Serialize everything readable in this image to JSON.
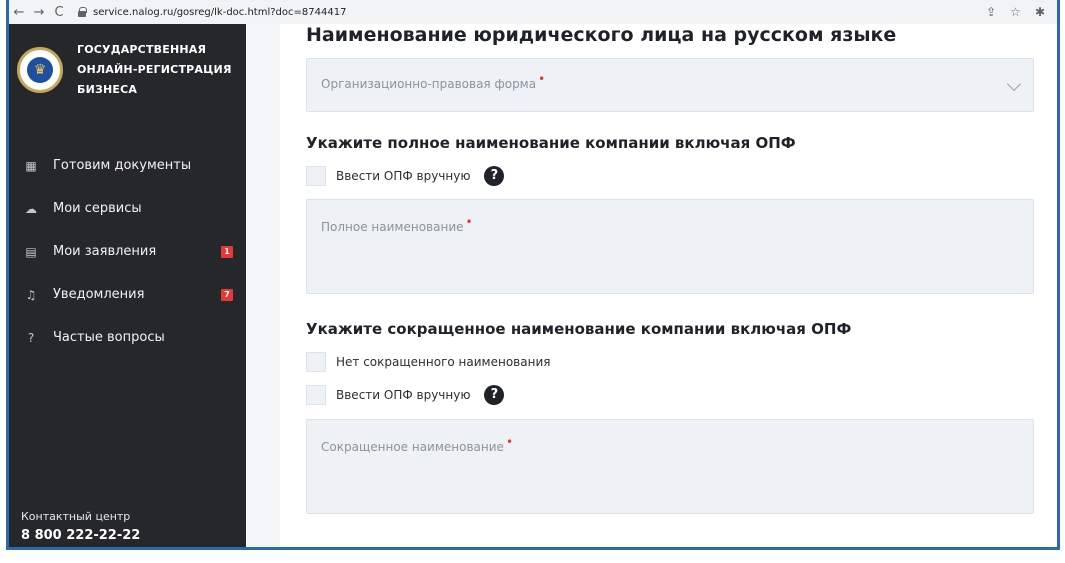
{
  "browser": {
    "back": "←",
    "forward": "→",
    "reload": "C",
    "url": "service.nalog.ru/gosreg/lk-doc.html?doc=8744417",
    "share": "⇪",
    "star": "☆",
    "ext": "✱"
  },
  "sidebar": {
    "logo_lines": [
      "ГОСУДАРСТВЕННАЯ",
      "ОНЛАЙН-РЕГИСТРАЦИЯ",
      "БИЗНЕСА"
    ],
    "items": [
      {
        "label": "Готовим документы",
        "icon": "▦",
        "badge": ""
      },
      {
        "label": "Мои сервисы",
        "icon": "☁",
        "badge": ""
      },
      {
        "label": "Мои заявления",
        "icon": "▤",
        "badge": "1"
      },
      {
        "label": "Уведомления",
        "icon": "♫",
        "badge": "7"
      },
      {
        "label": "Частые вопросы",
        "icon": "?",
        "badge": ""
      }
    ],
    "contact_label": "Контактный центр",
    "contact_phone": "8 800 222-22-22"
  },
  "form": {
    "title": "Наименование юридического лица на русском языке",
    "opf_placeholder": "Организационно-правовая форма",
    "required_mark": "•",
    "full": {
      "heading": "Укажите полное наименование компании включая ОПФ",
      "manual_opf": "Ввести ОПФ вручную",
      "placeholder": "Полное наименование"
    },
    "short": {
      "heading": "Укажите сокращенное наименование компании включая ОПФ",
      "no_short": "Нет сокращенного наименования",
      "manual_opf": "Ввести ОПФ вручную",
      "placeholder": "Сокращенное наименование"
    },
    "help_glyph": "?"
  }
}
